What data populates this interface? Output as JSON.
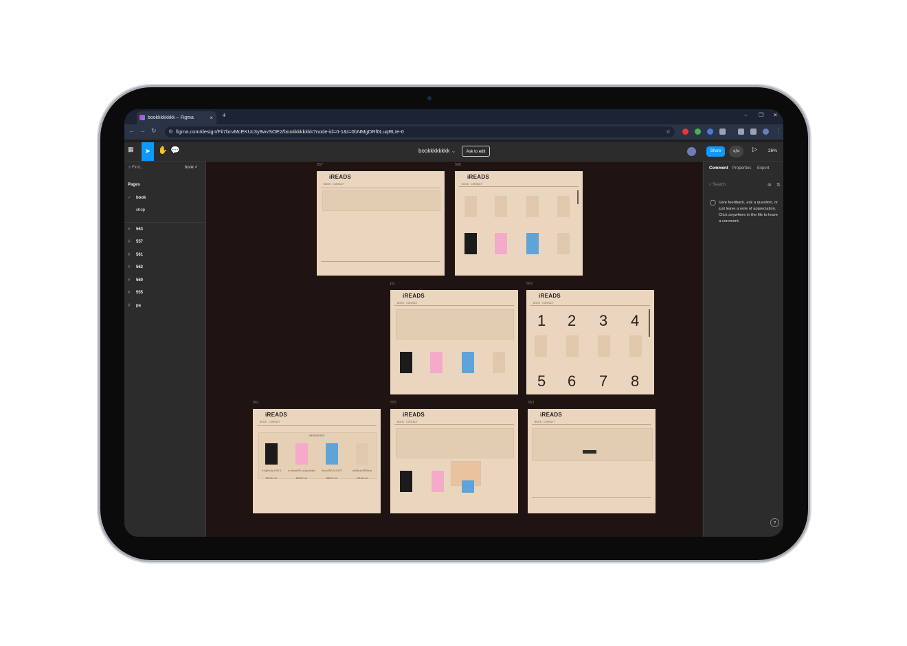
{
  "browser": {
    "tab_title": "bookkkkkkkk – Figma",
    "new_tab": "+",
    "url": "figma.com/design/Fii7bcvMcEKUc3y8wvSOE2/bookkkkkkkk?node-id=0-1&t=0bNMgDRf0LuqRLIe-0",
    "win_min": "−",
    "win_max": "❐",
    "win_close": "✕"
  },
  "figma": {
    "file_name": "bookkkkkkkk",
    "ask_to_edit": "Ask to edit",
    "share": "Share",
    "zoom": "26%"
  },
  "left_panel": {
    "find": "Find...",
    "page_selector": "book",
    "pages_heading": "Pages",
    "pages": [
      "book",
      "shop"
    ],
    "frames": [
      "563",
      "557",
      "561",
      "562",
      "560",
      "555",
      "pa"
    ]
  },
  "right_panel": {
    "tabs": [
      "Comment",
      "Properties",
      "Export"
    ],
    "search": "Search",
    "message": "Give feedback, ask a question, or just leave a note of appreciation. Click anywhere in the file to leave a comment.",
    "help": "?"
  },
  "canvas": {
    "frames": [
      {
        "label": "557"
      },
      {
        "label": "560"
      },
      {
        "label": "pa"
      },
      {
        "label": "562"
      },
      {
        "label": "561"
      },
      {
        "label": "555"
      },
      {
        "label": "563"
      }
    ],
    "logo": "iREADS",
    "nav_book": "BOOK",
    "nav_contact": "CONTACT",
    "new_books": "NEW BOOKS",
    "numbers": [
      "1",
      "2",
      "3",
      "4",
      "5",
      "6",
      "7",
      "8"
    ],
    "book_titles": [
      "สามผู้กำเนิด 1200 ปี",
      "สาวน้อยหัวใจ แมกนูมเดินฝัน",
      "ศิลปะหรือไม่ 8,000 ปี",
      "หนังสือเล่ม ที่ไม่มีเลย"
    ],
    "prices": [
      "300.00 บาท",
      "280.00 บาท",
      "285.00 บาท",
      "175.00 บาท"
    ]
  }
}
